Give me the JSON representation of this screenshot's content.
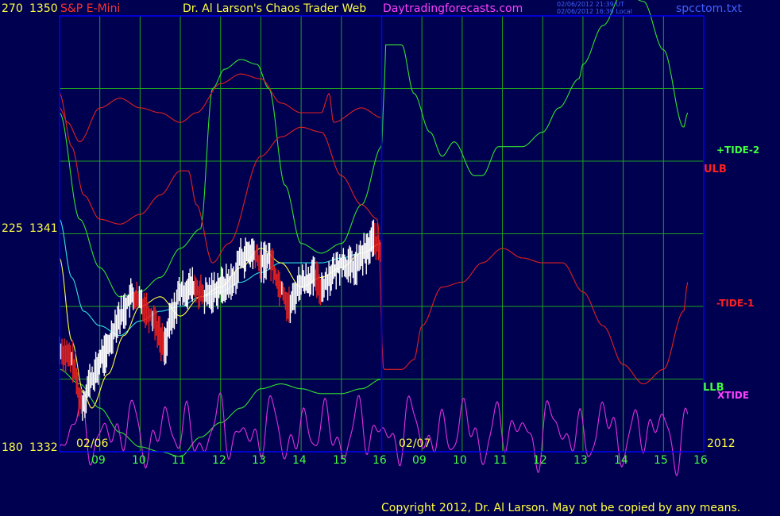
{
  "header": {
    "symbol": "S&P E-Mini",
    "title": "Dr. Al Larson's Chaos Trader Web",
    "site": "Daytradingforecasts.com",
    "ut_time": "02/06/2012 21:39 UT",
    "local_time": "02/06/2012 16:39 Local",
    "filename": "spcctom.txt"
  },
  "y_axis": {
    "labels": [
      {
        "left": "270",
        "right": "1350"
      },
      {
        "left": "225",
        "right": "1341"
      },
      {
        "left": "180",
        "right": "1332"
      }
    ]
  },
  "date_labels": [
    "02/06",
    "02/07"
  ],
  "year_label": "2012",
  "hour_labels": [
    "09",
    "10",
    "11",
    "12",
    "13",
    "14",
    "15",
    "16",
    "09",
    "10",
    "11",
    "12",
    "13",
    "14",
    "15",
    "16"
  ],
  "right_labels": {
    "tide2": "+TIDE-2",
    "ulb": "ULB",
    "tide1": "-TIDE-1",
    "llb": "LLB",
    "xtide": "XTIDE"
  },
  "copyright": "Copyright 2012, Dr. Al Larson. May not be copied by any means.",
  "colors": {
    "background": "#000050",
    "grid": "#20a020",
    "border": "#0000ff",
    "tide2": "#30e030",
    "tide1_ulb": "#e02020",
    "xtide": "#e030e0",
    "price": "#ffffff",
    "ma_cyan": "#30e0e0",
    "ma_yellow": "#ffff40"
  },
  "chart_data": {
    "type": "line",
    "x_unit": "hour",
    "x_domain": [
      8,
      24
    ],
    "y_axis_primary": {
      "label_values": [
        270,
        225,
        180
      ]
    },
    "y_axis_price": {
      "label_values": [
        1350,
        1341,
        1332
      ]
    },
    "series": [
      {
        "name": "+TIDE-2",
        "color_key": "tide2",
        "points": [
          [
            8,
            250
          ],
          [
            8.5,
            228
          ],
          [
            9,
            218
          ],
          [
            9.5,
            212
          ],
          [
            10,
            213
          ],
          [
            10.5,
            216
          ],
          [
            11,
            222
          ],
          [
            11.5,
            226
          ],
          [
            11.8,
            255
          ],
          [
            12.1,
            259
          ],
          [
            12.5,
            261
          ],
          [
            12.9,
            260
          ],
          [
            13.2,
            255
          ],
          [
            13.6,
            235
          ],
          [
            14,
            223
          ],
          [
            14.5,
            221
          ],
          [
            15,
            223
          ],
          [
            15.5,
            231
          ],
          [
            16,
            243
          ],
          [
            16.05,
            252
          ],
          [
            16.1,
            264
          ],
          [
            16.5,
            264
          ],
          [
            16.8,
            254
          ],
          [
            17.2,
            246
          ],
          [
            17.5,
            241
          ],
          [
            17.8,
            244
          ],
          [
            18.3,
            237
          ],
          [
            18.5,
            237
          ],
          [
            18.9,
            243
          ],
          [
            19.5,
            243
          ],
          [
            20,
            246
          ],
          [
            20.4,
            251
          ],
          [
            20.9,
            257
          ],
          [
            21,
            260
          ],
          [
            21.5,
            268
          ],
          [
            22,
            275
          ],
          [
            22.5,
            273
          ],
          [
            23,
            263
          ],
          [
            23.5,
            247
          ],
          [
            23.6,
            250
          ]
        ]
      },
      {
        "name": "ULB",
        "color_key": "tide1_ulb",
        "points": [
          [
            8,
            251
          ],
          [
            8.2,
            248
          ],
          [
            8.5,
            244
          ],
          [
            9,
            251
          ],
          [
            9.5,
            253
          ],
          [
            10,
            251
          ],
          [
            10.5,
            250
          ],
          [
            11,
            248
          ],
          [
            11.4,
            250
          ],
          [
            12,
            256
          ],
          [
            12.5,
            258
          ],
          [
            13,
            257
          ],
          [
            13.5,
            252
          ],
          [
            14,
            250
          ],
          [
            14.5,
            250
          ],
          [
            14.7,
            254
          ],
          [
            14.8,
            248
          ],
          [
            15.5,
            251
          ],
          [
            16,
            249
          ]
        ]
      },
      {
        "name": "-TIDE-1",
        "color_key": "tide1_ulb",
        "points": [
          [
            8,
            254
          ],
          [
            8.3,
            243
          ],
          [
            8.6,
            233
          ],
          [
            9,
            228
          ],
          [
            9.5,
            227
          ],
          [
            10,
            229
          ],
          [
            10.5,
            233
          ],
          [
            11,
            238
          ],
          [
            11.2,
            238
          ],
          [
            11.4,
            231
          ],
          [
            11.8,
            219
          ],
          [
            12.2,
            223
          ],
          [
            13,
            241
          ],
          [
            13.5,
            245
          ],
          [
            14,
            247
          ],
          [
            14.5,
            246
          ],
          [
            15,
            237
          ],
          [
            15.5,
            231
          ],
          [
            15.9,
            228
          ],
          [
            16.05,
            197
          ],
          [
            16.5,
            197
          ],
          [
            16.8,
            199
          ],
          [
            17,
            206
          ],
          [
            17.5,
            214
          ],
          [
            18,
            215
          ],
          [
            18.5,
            219
          ],
          [
            19,
            222
          ],
          [
            19.5,
            220
          ],
          [
            20,
            219
          ],
          [
            20.5,
            219
          ],
          [
            21,
            213
          ],
          [
            21.5,
            206
          ],
          [
            22,
            198
          ],
          [
            22.5,
            194
          ],
          [
            23,
            197
          ],
          [
            23.5,
            209
          ],
          [
            23.6,
            215
          ]
        ]
      },
      {
        "name": "LLB",
        "color_key": "tide2",
        "points": [
          [
            8,
            197
          ],
          [
            8.5,
            194
          ],
          [
            9,
            189
          ],
          [
            9.5,
            184
          ],
          [
            10,
            181
          ],
          [
            10.5,
            180
          ],
          [
            11,
            179
          ],
          [
            11.5,
            183
          ],
          [
            12,
            186
          ],
          [
            12.5,
            189
          ],
          [
            13,
            193
          ],
          [
            13.5,
            194
          ],
          [
            14,
            193
          ],
          [
            14.5,
            192
          ],
          [
            15,
            192
          ],
          [
            15.5,
            193
          ],
          [
            16,
            195
          ]
        ]
      },
      {
        "name": "XTIDE",
        "color_key": "xtide",
        "fn": "xtide",
        "range": [
          8,
          23.6
        ]
      },
      {
        "name": "",
        "color_key": "ma_cyan",
        "points": [
          [
            8,
            228
          ],
          [
            8.3,
            216
          ],
          [
            8.6,
            209
          ],
          [
            9,
            206
          ],
          [
            9.5,
            204
          ],
          [
            10,
            207
          ],
          [
            10.5,
            209
          ],
          [
            11,
            210
          ],
          [
            11.5,
            212
          ],
          [
            12,
            213
          ],
          [
            12.5,
            215
          ],
          [
            13,
            217
          ],
          [
            13.5,
            219
          ],
          [
            14,
            219
          ],
          [
            14.5,
            219
          ],
          [
            15,
            220
          ],
          [
            15.5,
            221
          ],
          [
            16,
            223
          ]
        ]
      },
      {
        "name": "",
        "color_key": "ma_yellow",
        "points": [
          [
            8,
            220
          ],
          [
            8.3,
            203
          ],
          [
            8.6,
            192
          ],
          [
            8.8,
            189
          ],
          [
            9.2,
            196
          ],
          [
            9.6,
            204
          ],
          [
            10,
            210
          ],
          [
            10.5,
            212
          ],
          [
            11,
            208
          ],
          [
            11.5,
            212
          ],
          [
            12,
            214
          ],
          [
            12.5,
            218
          ],
          [
            13,
            222
          ],
          [
            13.5,
            219
          ],
          [
            14,
            214
          ],
          [
            14.5,
            216
          ],
          [
            15,
            218
          ],
          [
            15.5,
            221
          ],
          [
            16,
            223
          ]
        ]
      }
    ],
    "price_bars": {
      "name": "",
      "color_key": "price",
      "down_color_key": "tide1_ulb",
      "x_range": [
        8,
        16
      ],
      "anchors": [
        [
          8,
          201
        ],
        [
          8.3,
          199
        ],
        [
          8.55,
          190
        ],
        [
          8.8,
          195
        ],
        [
          9.1,
          200
        ],
        [
          9.5,
          208
        ],
        [
          9.8,
          212
        ],
        [
          10,
          211
        ],
        [
          10.3,
          208
        ],
        [
          10.6,
          202
        ],
        [
          10.8,
          208
        ],
        [
          11,
          213
        ],
        [
          11.3,
          214
        ],
        [
          11.6,
          212
        ],
        [
          12,
          214
        ],
        [
          12.3,
          215
        ],
        [
          12.5,
          220
        ],
        [
          12.8,
          221
        ],
        [
          13,
          219
        ],
        [
          13.2,
          220
        ],
        [
          13.5,
          214
        ],
        [
          13.7,
          210
        ],
        [
          14,
          215
        ],
        [
          14.3,
          216
        ],
        [
          14.5,
          214
        ],
        [
          14.8,
          217
        ],
        [
          15,
          219
        ],
        [
          15.3,
          218
        ],
        [
          15.6,
          221
        ],
        [
          15.8,
          224
        ],
        [
          16,
          221
        ]
      ]
    }
  }
}
